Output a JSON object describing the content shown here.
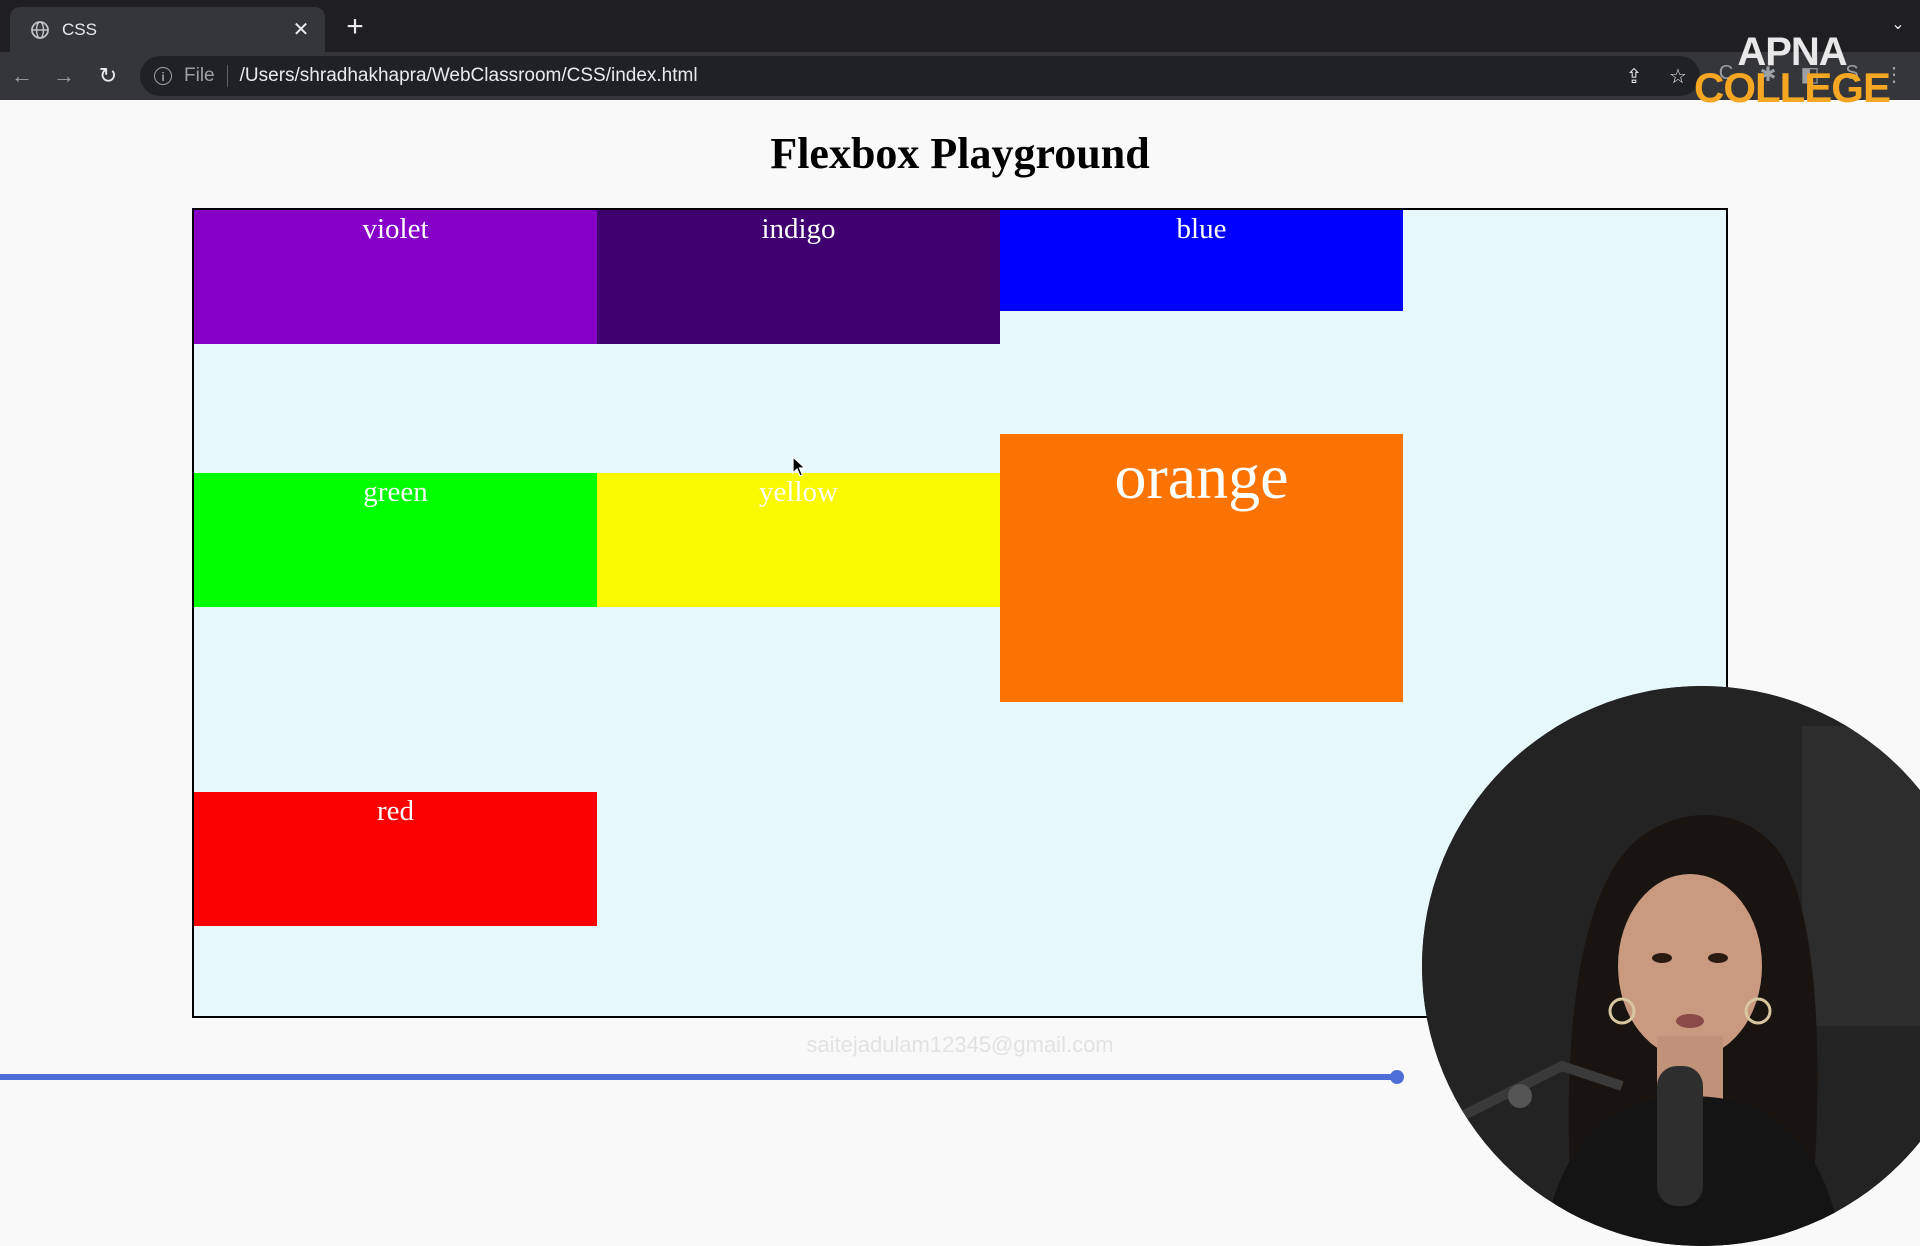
{
  "browser": {
    "tab_title": "CSS",
    "close_glyph": "✕",
    "new_tab_glyph": "+",
    "tab_menu_glyph": "⌄",
    "back_glyph": "←",
    "forward_glyph": "→",
    "reload_glyph": "↻",
    "info_glyph": "i",
    "scheme_label": "File",
    "url": "/Users/shradhakhapra/WebClassroom/CSS/index.html",
    "share_glyph": "⇪",
    "star_glyph": "☆",
    "ext_glyphs": [
      "C",
      "✱",
      "◧",
      "S",
      "⋮"
    ]
  },
  "watermark": {
    "line1": "APNA",
    "line2": "COLLEGE"
  },
  "page": {
    "heading": "Flexbox Playground",
    "boxes": [
      {
        "label": "violet",
        "color": "#8700c8"
      },
      {
        "label": "indigo",
        "color": "#3f0070"
      },
      {
        "label": "blue",
        "color": "#0000ff"
      },
      {
        "label": "green",
        "color": "#00ff00"
      },
      {
        "label": "yellow",
        "color": "#f9f900"
      },
      {
        "label": "orange",
        "color": "#fa7303"
      },
      {
        "label": "red",
        "color": "#fa0000"
      }
    ],
    "container_bg": "#e7f8fb",
    "email_overlay": "saitejadulam12345@gmail.com"
  },
  "icons": {
    "tab_favicon": "globe-icon",
    "cursor": "mouse-pointer-icon"
  }
}
